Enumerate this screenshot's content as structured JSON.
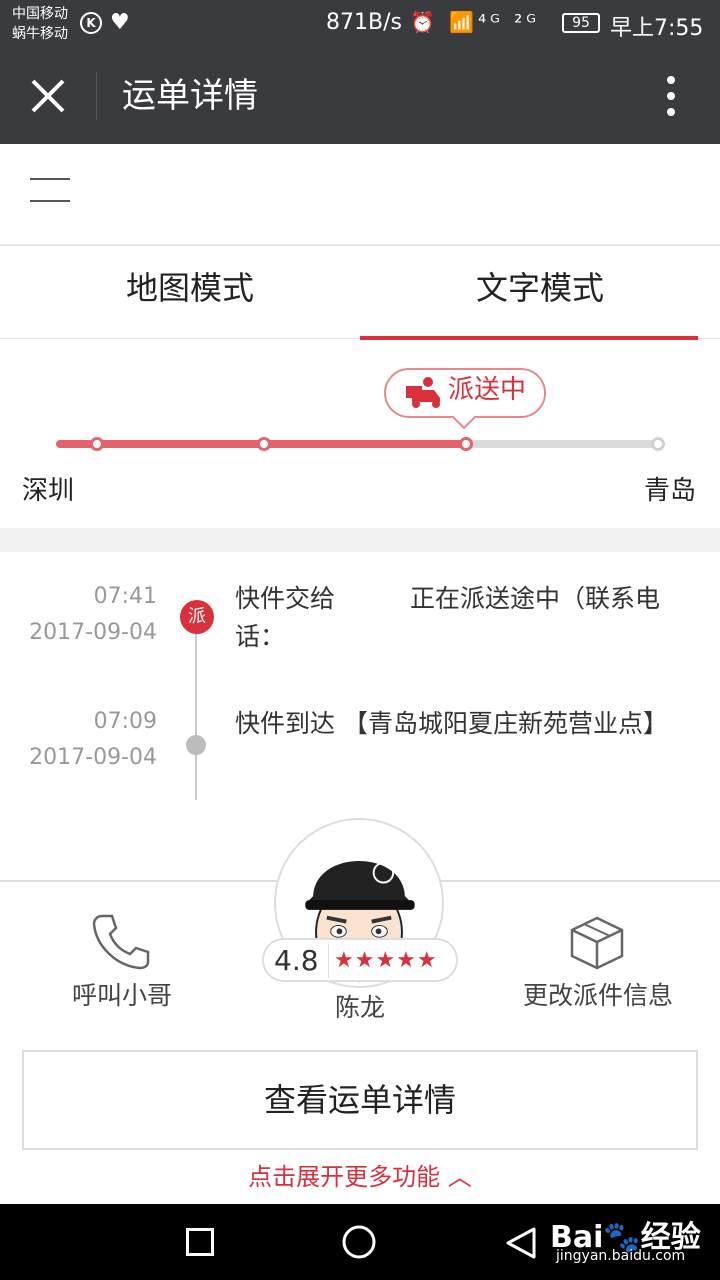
{
  "status_bar": {
    "carrier_1": "中国移动",
    "carrier_2": "蜗牛移动",
    "k_icon_text": "K",
    "net_speed": "871B/s",
    "signal_icons": "⏰ 📶⁴ᴳ ²ᴳ",
    "battery": "95",
    "time": "早上7:55"
  },
  "title_bar": {
    "title": "运单详情"
  },
  "tabs": [
    {
      "label": "地图模式"
    },
    {
      "label": "文字模式"
    }
  ],
  "progress": {
    "status_label": "派送中",
    "from_city": "深圳",
    "to_city": "青岛",
    "completed_steps": 3,
    "total_steps": 4
  },
  "timeline": [
    {
      "time": "07:41",
      "date": "2017-09-04",
      "badge": "派",
      "text": "快件交给　　　正在派送途中（联系电话：",
      "active": true
    },
    {
      "time": "07:09",
      "date": "2017-09-04",
      "text": "快件到达 【青岛城阳夏庄新苑营业点】",
      "active": false
    }
  ],
  "actions": {
    "call_label": "呼叫小哥",
    "change_label": "更改派件信息"
  },
  "courier": {
    "name": "陈龙",
    "rating": "4.8",
    "stars": "★★★★★"
  },
  "detail_button": "查看运单详情",
  "expand_label": "点击展开更多功能 ︿",
  "watermark": {
    "brand": "Bai🐾经验",
    "url": "jingyan.baidu.com"
  },
  "colors": {
    "accent": "#d9303c",
    "bar": "#3a3b3f",
    "track_done": "#e4636b",
    "track_todo": "#dadbdd"
  }
}
